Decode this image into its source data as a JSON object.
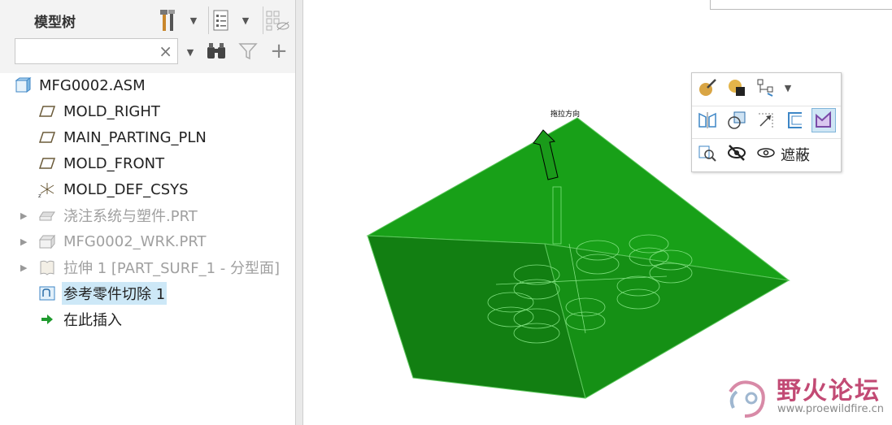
{
  "panel": {
    "title": "模型树",
    "search": {
      "value": "",
      "placeholder": "",
      "clear": "×"
    }
  },
  "tree": [
    {
      "label": "MFG0002.ASM",
      "icon": "assembly-icon",
      "gray": false,
      "expander": false
    },
    {
      "label": "MOLD_RIGHT",
      "icon": "datum-plane-icon",
      "gray": false,
      "expander": false
    },
    {
      "label": "MAIN_PARTING_PLN",
      "icon": "datum-plane-icon",
      "gray": false,
      "expander": false
    },
    {
      "label": "MOLD_FRONT",
      "icon": "datum-plane-icon",
      "gray": false,
      "expander": false
    },
    {
      "label": "MOLD_DEF_CSYS",
      "icon": "coordinate-system-icon",
      "gray": false,
      "expander": false
    },
    {
      "label": "浇注系统与塑件.PRT",
      "icon": "part-icon",
      "gray": true,
      "expander": true
    },
    {
      "label": "MFG0002_WRK.PRT",
      "icon": "workpiece-icon",
      "gray": true,
      "expander": true
    },
    {
      "label": "拉伸 1 [PART_SURF_1 - 分型面]",
      "icon": "extrude-surface-icon",
      "gray": true,
      "expander": true
    },
    {
      "label": "参考零件切除 1",
      "icon": "reference-part-cutout-icon",
      "gray": false,
      "expander": false,
      "selected": true
    },
    {
      "label": "在此插入",
      "icon": "insert-here-arrow-icon",
      "gray": false,
      "expander": false
    }
  ],
  "viewport": {
    "direction_label": "拖拉方向",
    "mini_toolbar": {
      "mask_label": "遮蔽"
    },
    "model_color": "#149c14"
  },
  "watermark": {
    "name": "野火论坛",
    "url": "www.proewildfire.cn"
  }
}
